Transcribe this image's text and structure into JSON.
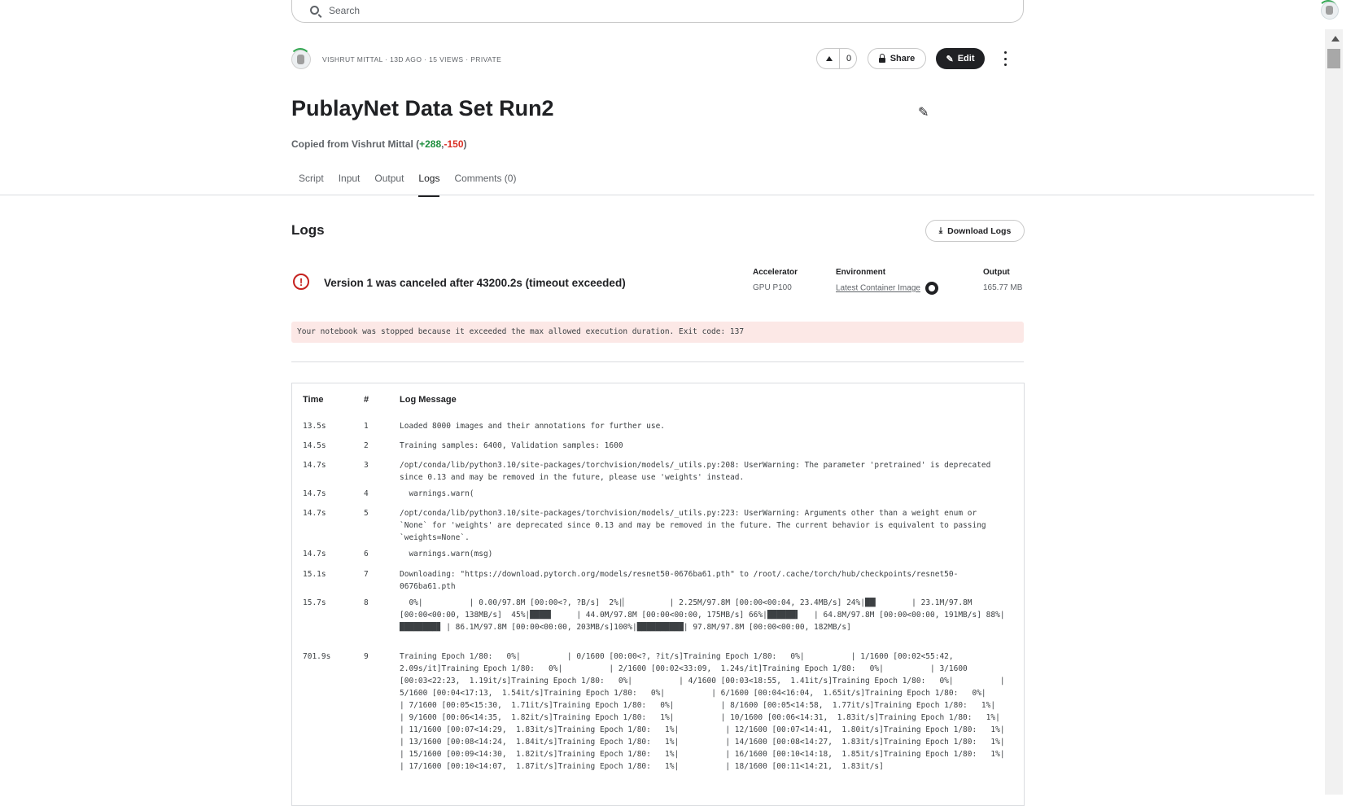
{
  "search": {
    "placeholder": "Search"
  },
  "meta": {
    "text": "VISHRUT MITTAL · 13D AGO · 15 VIEWS · PRIVATE"
  },
  "actions": {
    "vote_count": "0",
    "share_label": "Share",
    "edit_label": "Edit"
  },
  "notebook": {
    "title": "PublayNet Data Set Run2",
    "copied_prefix": "Copied from Vishrut Mittal (",
    "added": "+288",
    "comma": ",",
    "removed": "-150",
    "copied_suffix": ")"
  },
  "tabs": [
    "Script",
    "Input",
    "Output",
    "Logs",
    "Comments (0)"
  ],
  "logs": {
    "heading": "Logs",
    "download_label": "Download Logs",
    "status_message": "Version 1 was canceled after 43200.2s (timeout exceeded)",
    "accelerator_label": "Accelerator",
    "accelerator_value": "GPU P100",
    "environment_label": "Environment",
    "environment_value": "Latest Container Image",
    "output_label": "Output",
    "output_value": "165.77 MB",
    "error_text": "Your notebook was stopped because it exceeded the max allowed execution duration. Exit code: 137",
    "col_time": "Time",
    "col_num": "#",
    "col_message": "Log Message",
    "rows": [
      {
        "time": "13.5s",
        "num": "1",
        "message": "Loaded 8000 images and their annotations for further use."
      },
      {
        "time": "14.5s",
        "num": "2",
        "message": "Training samples: 6400, Validation samples: 1600"
      },
      {
        "time": "14.7s",
        "num": "3",
        "message": "/opt/conda/lib/python3.10/site-packages/torchvision/models/_utils.py:208: UserWarning: The parameter 'pretrained' is deprecated since 0.13 and may be removed in the future, please use 'weights' instead."
      },
      {
        "time": "14.7s",
        "num": "4",
        "message": "  warnings.warn("
      },
      {
        "time": "14.7s",
        "num": "5",
        "message": "/opt/conda/lib/python3.10/site-packages/torchvision/models/_utils.py:223: UserWarning: Arguments other than a weight enum or `None` for 'weights' are deprecated since 0.13 and may be removed in the future. The current behavior is equivalent to passing `weights=None`."
      },
      {
        "time": "14.7s",
        "num": "6",
        "message": "  warnings.warn(msg)"
      },
      {
        "time": "15.1s",
        "num": "7",
        "message": "Downloading: \"https://download.pytorch.org/models/resnet50-0676ba61.pth\" to /root/.cache/torch/hub/checkpoints/resnet50-0676ba61.pth"
      },
      {
        "time": "15.7s",
        "num": "8",
        "message": "  0%|          | 0.00/97.8M [00:00<?, ?B/s]  2%|▏         | 2.25M/97.8M [00:00<00:04, 23.4MB/s] 24%|██▎       | 23.1M/97.8M [00:00<00:00, 138MB/s]  45%|████▌     | 44.0M/97.8M [00:00<00:00, 175MB/s] 66%|██████▌   | 64.8M/97.8M [00:00<00:00, 191MB/s] 88%|████████▊ | 86.1M/97.8M [00:00<00:00, 203MB/s]100%|██████████| 97.8M/97.8M [00:00<00:00, 182MB/s]"
      },
      {
        "time": "701.9s",
        "num": "9",
        "message": "Training Epoch 1/80:   0%|          | 0/1600 [00:00<?, ?it/s]Training Epoch 1/80:   0%|          | 1/1600 [00:02<55:42,  2.09s/it]Training Epoch 1/80:   0%|          | 2/1600 [00:02<33:09,  1.24s/it]Training Epoch 1/80:   0%|          | 3/1600 [00:03<22:23,  1.19it/s]Training Epoch 1/80:   0%|          | 4/1600 [00:03<18:55,  1.41it/s]Training Epoch 1/80:   0%|          | 5/1600 [00:04<17:13,  1.54it/s]Training Epoch 1/80:   0%|          | 6/1600 [00:04<16:04,  1.65it/s]Training Epoch 1/80:   0%|          | 7/1600 [00:05<15:30,  1.71it/s]Training Epoch 1/80:   0%|          | 8/1600 [00:05<14:58,  1.77it/s]Training Epoch 1/80:   1%|          | 9/1600 [00:06<14:35,  1.82it/s]Training Epoch 1/80:   1%|          | 10/1600 [00:06<14:31,  1.83it/s]Training Epoch 1/80:   1%|          | 11/1600 [00:07<14:29,  1.83it/s]Training Epoch 1/80:   1%|          | 12/1600 [00:07<14:41,  1.80it/s]Training Epoch 1/80:   1%|          | 13/1600 [00:08<14:24,  1.84it/s]Training Epoch 1/80:   1%|          | 14/1600 [00:08<14:27,  1.83it/s]Training Epoch 1/80:   1%|          | 15/1600 [00:09<14:30,  1.82it/s]Training Epoch 1/80:   1%|          | 16/1600 [00:10<14:18,  1.85it/s]Training Epoch 1/80:   1%|          | 17/1600 [00:10<14:07,  1.87it/s]Training Epoch 1/80:   1%|          | 18/1600 [00:11<14:21,  1.83it/s]"
      }
    ]
  }
}
